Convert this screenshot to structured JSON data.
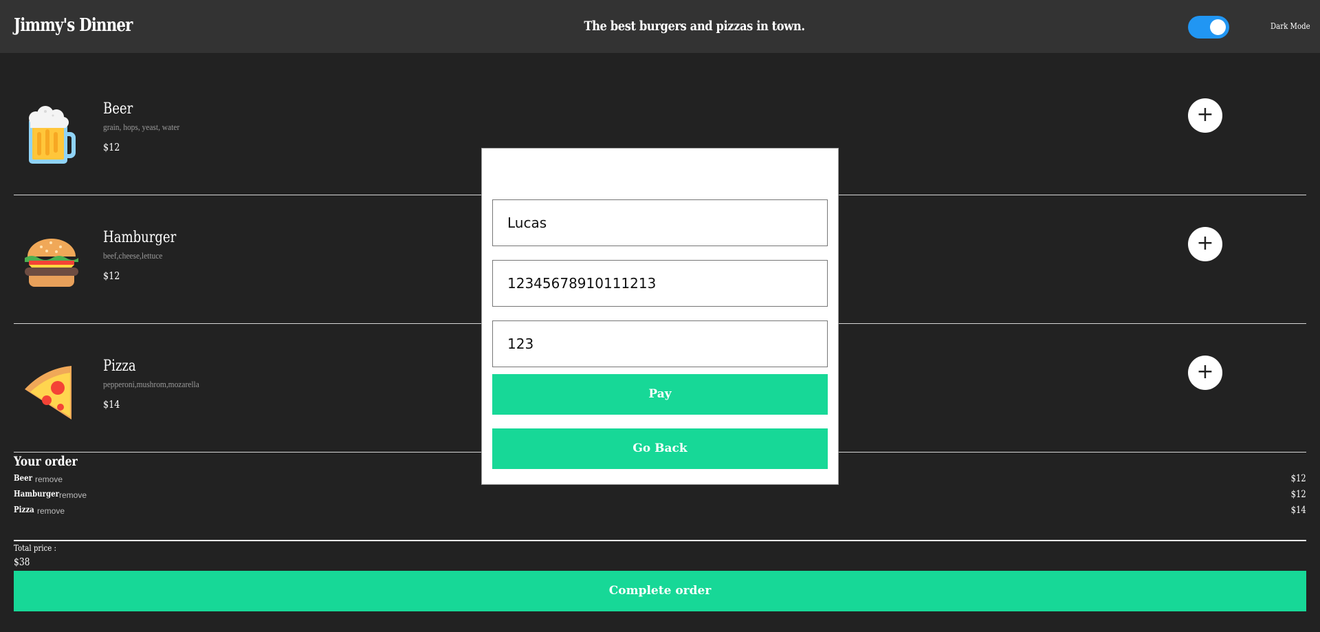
{
  "header": {
    "brand": "Jimmy's Dinner",
    "tagline": "The best burgers and pizzas in town.",
    "dark_mode_label": "Dark Mode",
    "dark_mode_on": true,
    "toggle_color": "#2196f3"
  },
  "menu": [
    {
      "name": "Beer",
      "ingredients": "grain, hops, yeast, water",
      "price": "$12",
      "icon": "beer-mug-icon",
      "add_label": "+"
    },
    {
      "name": "Hamburger",
      "ingredients": "beef,cheese,lettuce",
      "price": "$12",
      "icon": "hamburger-icon",
      "add_label": "+"
    },
    {
      "name": "Pizza",
      "ingredients": "pepperoni,mushrom,mozarella",
      "price": "$14",
      "icon": "pizza-slice-icon",
      "add_label": "+"
    }
  ],
  "order": {
    "title": "Your order",
    "items": [
      {
        "name": "Beer",
        "remove_label": "remove",
        "price": "$12"
      },
      {
        "name": "Hamburger",
        "remove_label": "remove",
        "price": "$12"
      },
      {
        "name": "Pizza",
        "remove_label": "remove",
        "price": "$14"
      }
    ],
    "total_label": "Total price :",
    "total_value": "$38",
    "complete_label": "Complete order"
  },
  "payment_modal": {
    "name_value": "Lucas",
    "card_value": "12345678910111213",
    "cvv_value": "123",
    "pay_label": "Pay",
    "back_label": "Go Back"
  },
  "colors": {
    "accent": "#17d897",
    "background": "#222222",
    "header": "#333333"
  }
}
